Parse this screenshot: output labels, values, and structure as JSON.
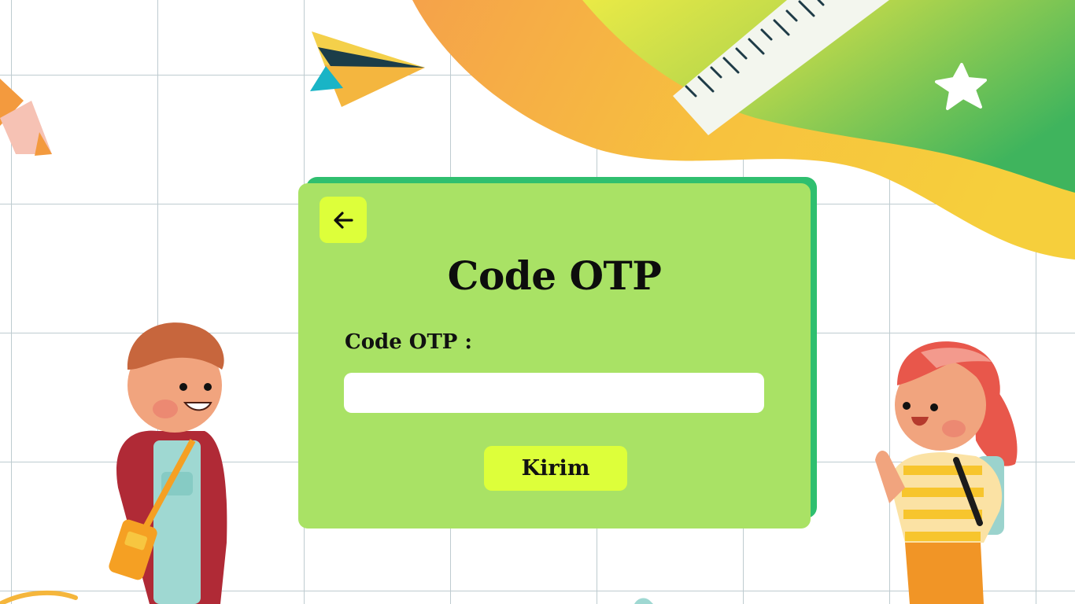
{
  "otp_form": {
    "back_icon": "arrow-left-icon",
    "title": "Code OTP",
    "field_label": "Code OTP :",
    "input_value": "",
    "submit_label": "Kirim"
  },
  "colors": {
    "card": "#a9e265",
    "card_shadow": "#2fbf6f",
    "button": "#ddff3a",
    "input": "#ffffff",
    "background": "#ffffff"
  }
}
